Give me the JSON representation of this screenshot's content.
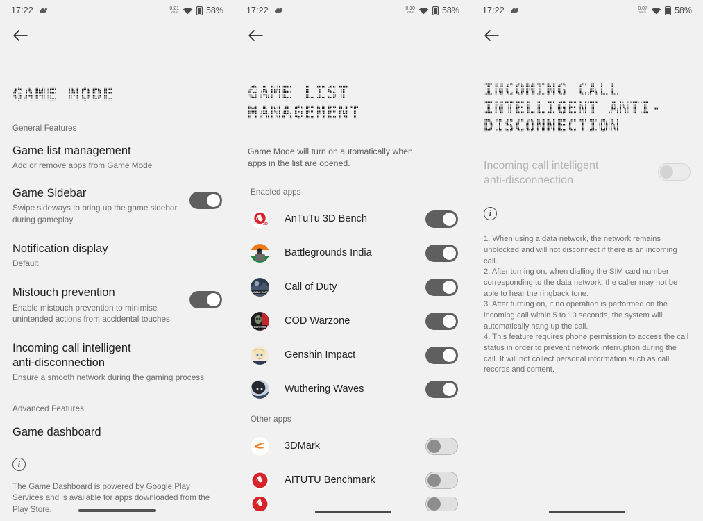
{
  "statusbar": {
    "time": "17:22",
    "notification_icon": "cloud-notification-icon",
    "netspeed_value_p1": "0.21",
    "netspeed_value_p2": "0.10",
    "netspeed_value_p3": "0.07",
    "netspeed_unit": "KB/s",
    "wifi_icon": "wifi-icon",
    "battery_icon": "battery-icon",
    "battery_pct": "58%"
  },
  "panel1": {
    "back_icon": "back-arrow-icon",
    "title": "GAME MODE",
    "section_general": "General Features",
    "section_advanced": "Advanced Features",
    "rows": [
      {
        "title": "Game list management",
        "sub": "Add or remove apps from Game Mode",
        "toggle": "none"
      },
      {
        "title": "Game Sidebar",
        "sub": "Swipe sideways to bring up the game sidebar during gameplay",
        "toggle": "on"
      },
      {
        "title": "Notification display",
        "sub": "Default",
        "toggle": "none"
      },
      {
        "title": "Mistouch prevention",
        "sub": "Enable mistouch prevention to minimise unintended actions from accidental touches",
        "toggle": "on"
      },
      {
        "title": "Incoming call intelligent anti-disconnection",
        "sub": "Ensure a smooth network during the gaming process",
        "toggle": "none"
      }
    ],
    "advanced_row": {
      "title": "Game dashboard"
    },
    "info_icon": "info-icon",
    "info_text": "The Game Dashboard is powered by Google Play Services and is available for apps downloaded from the Play Store."
  },
  "panel2": {
    "back_icon": "back-arrow-icon",
    "title": "GAME LIST MANAGEMENT",
    "description": "Game Mode will turn on automatically when apps in the list are opened.",
    "enabled_label": "Enabled apps",
    "other_label": "Other apps",
    "enabled_apps": [
      {
        "name": "AnTuTu 3D Bench",
        "toggle": "on",
        "icon": "antutu-3d-bench-app-icon"
      },
      {
        "name": "Battlegrounds India",
        "toggle": "on",
        "icon": "battlegrounds-india-app-icon"
      },
      {
        "name": "Call of Duty",
        "toggle": "on",
        "icon": "call-of-duty-app-icon"
      },
      {
        "name": "COD Warzone",
        "toggle": "on",
        "icon": "cod-warzone-app-icon"
      },
      {
        "name": "Genshin Impact",
        "toggle": "on",
        "icon": "genshin-impact-app-icon"
      },
      {
        "name": "Wuthering Waves",
        "toggle": "on",
        "icon": "wuthering-waves-app-icon"
      }
    ],
    "other_apps": [
      {
        "name": "3DMark",
        "toggle": "off",
        "icon": "3dmark-app-icon"
      },
      {
        "name": "AITUTU Benchmark",
        "toggle": "off",
        "icon": "aitutu-benchmark-app-icon"
      },
      {
        "name": "",
        "toggle": "off",
        "icon": "partial-app-icon"
      }
    ]
  },
  "panel3": {
    "back_icon": "back-arrow-icon",
    "title": "INCOMING CALL INTELLIGENT ANTI-DISCONNECTION",
    "row_title": "Incoming call intelligent anti-disconnection",
    "row_toggle": "off",
    "info_icon": "info-icon",
    "info_items": [
      "1. When using a data network, the network remains unblocked and will not disconnect if there is an incoming call.",
      "2. After turning on, when dialling the SIM card number corresponding to the data network, the caller may not be able to hear the ringback tone.",
      "3. After turning on, if no operation is performed on the incoming call within 5 to 10 seconds, the system will automatically hang up the call.",
      "4. This feature requires phone permission to access the call status in order to prevent network interruption during the call. It will not collect personal information such as call records and content."
    ]
  },
  "colors": {
    "background": "#f1f1f1",
    "toggle_on": "#5f5f5f",
    "toggle_off_track": "#e0e0e0",
    "text_primary": "#1f1f1f",
    "text_secondary": "#6d6d6d",
    "nav_pill": "#4a4a4a"
  }
}
